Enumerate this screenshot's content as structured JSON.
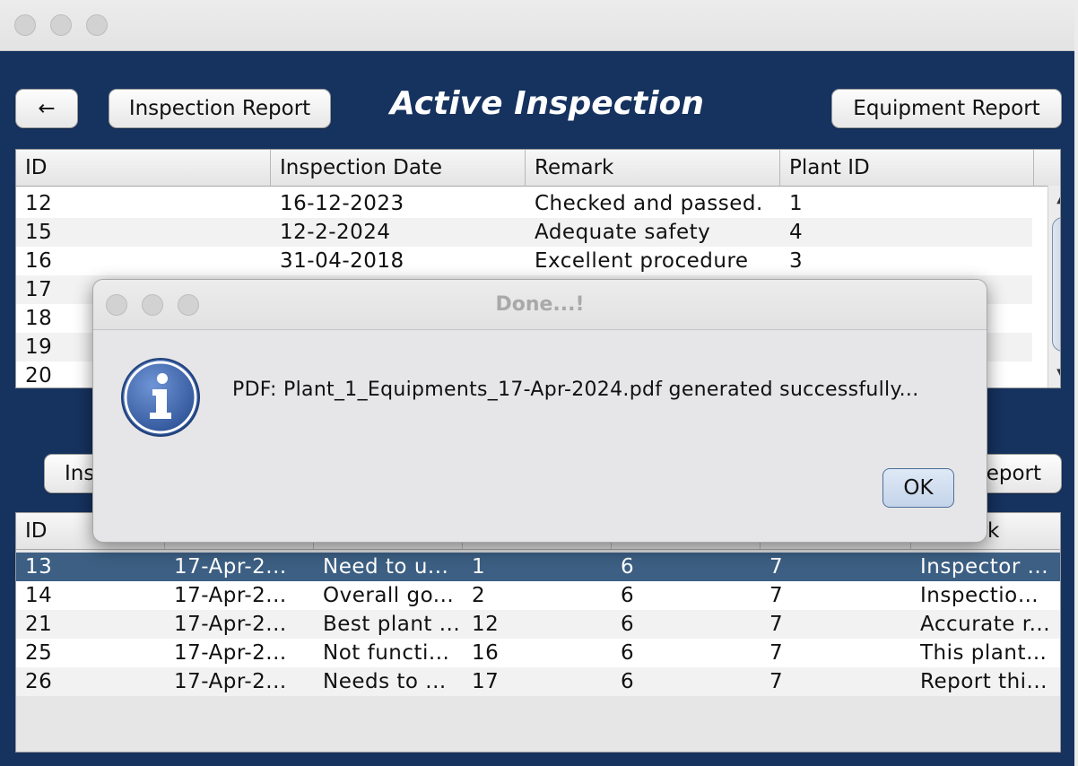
{
  "window": {
    "title": ""
  },
  "header": {
    "back_label": "←",
    "inspection_report_label": "Inspection Report",
    "title": "Active Inspection",
    "equipment_report_label": "Equipment Report"
  },
  "top_table": {
    "columns": [
      "ID",
      "Inspection Date",
      "Remark",
      "Plant ID"
    ],
    "rows": [
      [
        "12",
        "16-12-2023",
        "Checked and passed.",
        "1"
      ],
      [
        "15",
        "12-2-2024",
        "Adequate safety",
        "4"
      ],
      [
        "16",
        "31-04-2018",
        "Excellent procedure",
        "3"
      ],
      [
        "17",
        "",
        "",
        ""
      ],
      [
        "18",
        "",
        "",
        ""
      ],
      [
        "19",
        "",
        "",
        ""
      ],
      [
        "20",
        "",
        "",
        ""
      ]
    ],
    "scroll_up": "▲",
    "scroll_down": "▼"
  },
  "lower_buttons": {
    "left_label": "Ins",
    "right_label": "eport"
  },
  "bottom_table": {
    "columns": [
      "ID",
      "",
      "",
      "",
      "",
      "",
      "Remark"
    ],
    "rows": [
      [
        "13",
        "17-Apr-2...",
        "Need to u...",
        "1",
        "6",
        "7",
        "Inspector ..."
      ],
      [
        "14",
        "17-Apr-2...",
        "Overall go...",
        "2",
        "6",
        "7",
        "Inspection..."
      ],
      [
        "21",
        "17-Apr-2...",
        "Best plant ...",
        "12",
        "6",
        "7",
        "Accurate r..."
      ],
      [
        "25",
        "17-Apr-2...",
        "Not functi...",
        "16",
        "6",
        "7",
        "This plant ..."
      ],
      [
        "26",
        "17-Apr-2...",
        "Needs to ...",
        "17",
        "6",
        "7",
        "Report thi..."
      ]
    ],
    "selected_row": 0
  },
  "dialog": {
    "title": "Done...!",
    "message": "PDF: Plant_1_Equipments_17-Apr-2024.pdf generated successfully...",
    "ok_label": "OK",
    "icon": "info-icon"
  },
  "colors": {
    "background": "#16325f",
    "selected_row": "#3c5f83",
    "info_icon": "#2f5597"
  }
}
